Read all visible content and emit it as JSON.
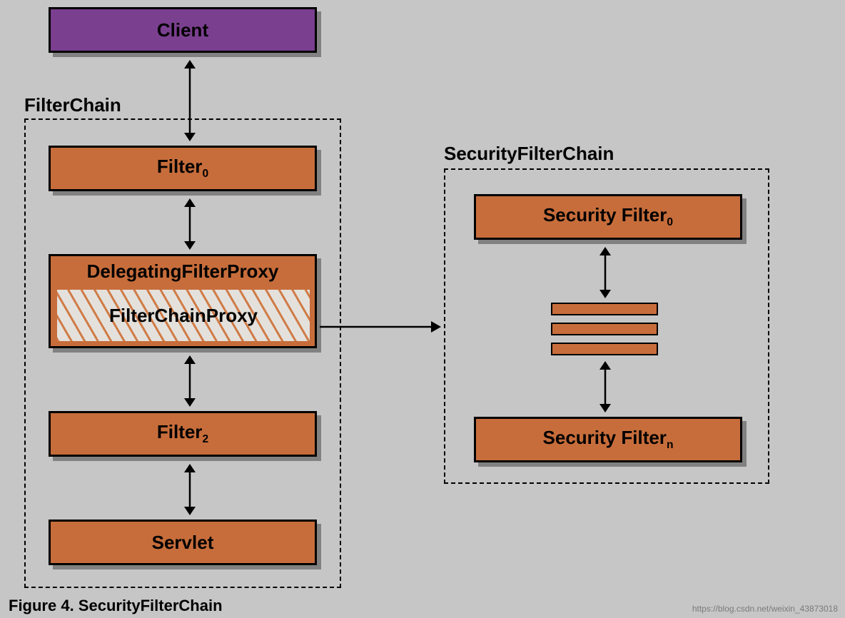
{
  "client": {
    "label": "Client"
  },
  "filterChain": {
    "label": "FilterChain",
    "filter0": {
      "name": "Filter",
      "sub": "0"
    },
    "delegating": {
      "title": "DelegatingFilterProxy",
      "inner": "FilterChainProxy"
    },
    "filter2": {
      "name": "Filter",
      "sub": "2"
    },
    "servlet": {
      "label": "Servlet"
    }
  },
  "securityChain": {
    "label": "SecurityFilterChain",
    "sf0": {
      "name": "Security Filter",
      "sub": "0"
    },
    "sfn": {
      "name": "Security Filter",
      "sub": "n"
    }
  },
  "caption": "Figure 4. SecurityFilterChain",
  "watermark": "https://blog.csdn.net/weixin_43873018"
}
